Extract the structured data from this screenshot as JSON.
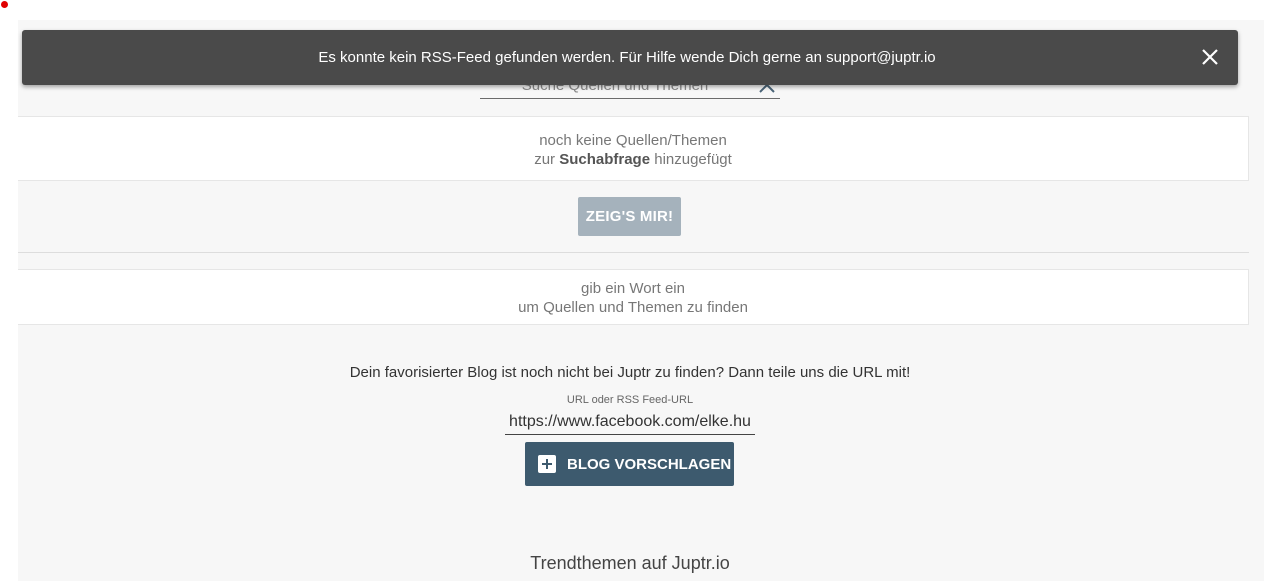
{
  "toast": {
    "message": "Es konnte kein RSS-Feed gefunden werden. Für Hilfe wende Dich gerne an support@juptr.io",
    "close_icon": "close-icon"
  },
  "search": {
    "placeholder": "Suche Quellen und Themen",
    "value": "",
    "clear_icon": "close-icon"
  },
  "selection_box": {
    "line1": "noch keine Quellen/Themen",
    "line2_prefix": "zur ",
    "line2_bold": "Suchabfrage",
    "line2_suffix": " hinzugefügt"
  },
  "show_button": {
    "label": "ZEIG'S MIR!"
  },
  "hint_box": {
    "line1": "gib ein Wort ein",
    "line2": "um Quellen und Themen zu finden"
  },
  "suggest": {
    "text": "Dein favorisierter Blog ist noch nicht bei Juptr zu finden? Dann teile uns die URL mit!",
    "field_label": "URL oder RSS Feed-URL",
    "field_value": "https://www.facebook.com/elke.hu",
    "button_label": "BLOG VORSCHLAGEN",
    "button_icon": "plus-box-icon"
  },
  "trends": {
    "title": "Trendthemen auf Juptr.io"
  },
  "colors": {
    "toast_bg": "#4a4a4a",
    "primary_button": "#3d5a6e",
    "disabled_button": "#a5b2bc",
    "page_bg": "#f7f7f7"
  }
}
